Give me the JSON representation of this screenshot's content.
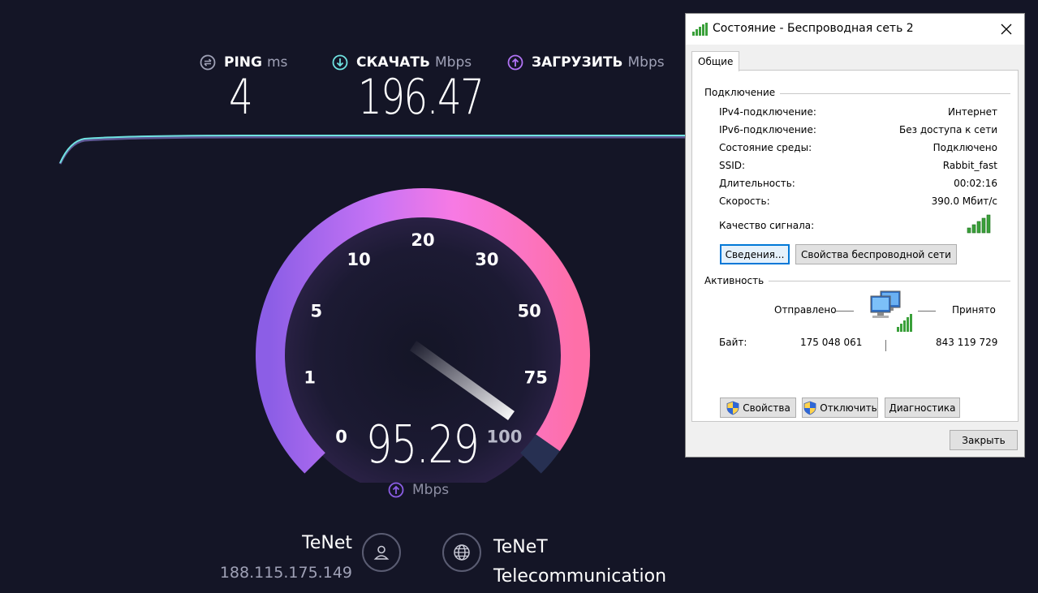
{
  "speedtest": {
    "ping": {
      "label": "PING",
      "unit": "ms",
      "value": "4"
    },
    "download": {
      "label": "СКАЧАТЬ",
      "unit": "Mbps",
      "value": "196.47"
    },
    "upload": {
      "label": "ЗАГРУЗИТЬ",
      "unit": "Mbps"
    },
    "gauge": {
      "ticks": [
        "0",
        "1",
        "5",
        "10",
        "20",
        "30",
        "50",
        "75",
        "100"
      ],
      "current_value": "95.29",
      "current_unit": "Mbps"
    },
    "isp": {
      "name": "TeNet",
      "ip": "188.115.175.149"
    },
    "server": {
      "name_line1": "TeNeT",
      "name_line2": "Telecommunication"
    },
    "colors": {
      "accent_cyan": "#6fe3e1",
      "accent_purple": "#b173f5",
      "gauge_pink": "#fe6fb2",
      "background": "#141526"
    }
  },
  "dialog": {
    "title": "Состояние - Беспроводная сеть 2",
    "tab": "Общие",
    "connection_group": "Подключение",
    "rows": [
      {
        "label": "IPv4-подключение:",
        "value": "Интернет"
      },
      {
        "label": "IPv6-подключение:",
        "value": "Без доступа к сети"
      },
      {
        "label": "Состояние среды:",
        "value": "Подключено"
      },
      {
        "label": "SSID:",
        "value": "Rabbit_fast"
      },
      {
        "label": "Длительность:",
        "value": "00:02:16"
      },
      {
        "label": "Скорость:",
        "value": "390.0 Мбит/с"
      }
    ],
    "signal_label": "Качество сигнала:",
    "details_button": "Сведения...",
    "wireless_props_button": "Свойства беспроводной сети",
    "activity_group": "Активность",
    "sent_label": "Отправлено",
    "received_label": "Принято",
    "bytes_label": "Байт:",
    "bytes_sent": "175 048 061",
    "bytes_received": "843 119 729",
    "properties_button": "Свойства",
    "disable_button": "Отключить",
    "diagnostics_button": "Диагностика",
    "close_button": "Закрыть"
  }
}
